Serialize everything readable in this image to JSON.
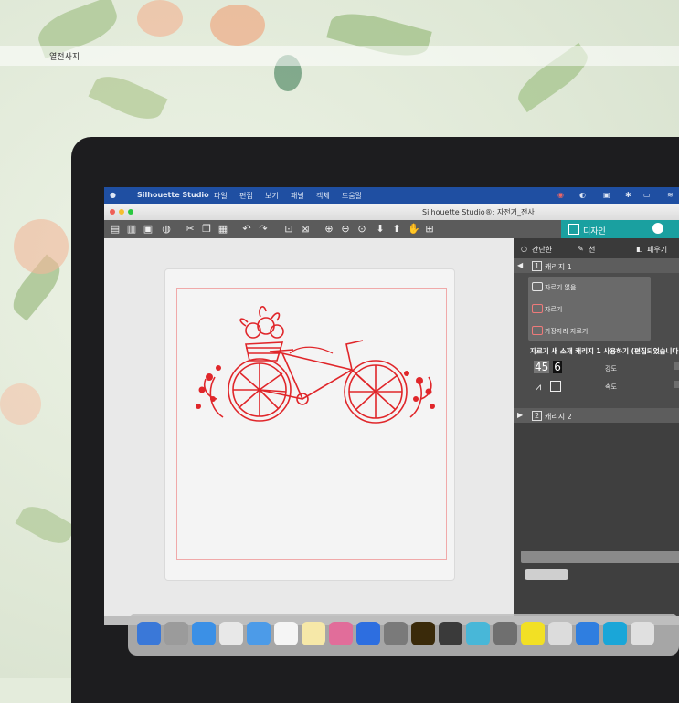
{
  "caption": "열전사지",
  "menubar": {
    "app_name": "Silhouette Studio",
    "items": [
      "파일",
      "편집",
      "보기",
      "패널",
      "객체",
      "도움말"
    ]
  },
  "window": {
    "title": "Silhouette Studio®: 자전거_전사"
  },
  "design_tab": {
    "label": "디자인"
  },
  "panel": {
    "tabs": [
      "간단한",
      "선",
      "패우기"
    ],
    "page1_label": "캐리지 1",
    "page1_number": "1",
    "tools": [
      "자르기 없음",
      "자르기",
      "가장자리 자르기"
    ],
    "info_text": "자르기 새 소재 캐리지 1 사용하기 (편집되었습니다.)",
    "digits_a": "45",
    "digits_b": "6",
    "force_label": "강도",
    "speed_label": "속도",
    "page2_label": "캐리지 2",
    "page2_number": "2"
  },
  "colors": {
    "menubar": "#1f4fa2",
    "accent": "#1aa0a0",
    "art": "#e0262a"
  }
}
